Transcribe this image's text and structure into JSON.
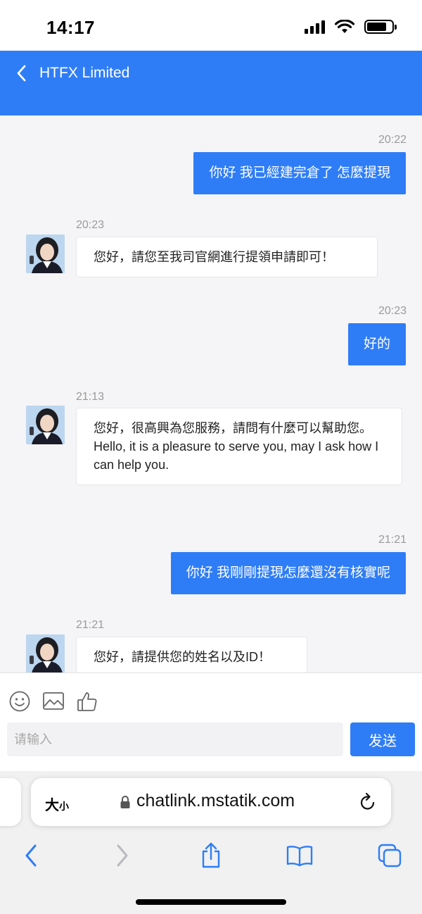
{
  "status_bar": {
    "time": "14:17"
  },
  "header": {
    "title": "HTFX Limited"
  },
  "messages": [
    {
      "time": "20:22",
      "text": "你好 我已經建完倉了 怎麼提現"
    },
    {
      "time": "20:23",
      "text": "您好，請您至我司官網進行提領申請即可！"
    },
    {
      "time": "20:23",
      "text": "好的"
    },
    {
      "time": "21:13",
      "text": "您好，很高興為您服務，請問有什麼可以幫助您。\nHello, it is a pleasure to serve you, may I ask how I can help you."
    },
    {
      "time": "21:21",
      "text": "你好 我剛剛提現怎麼還沒有核實呢"
    },
    {
      "time": "21:21",
      "text": "您好，請提供您的姓名以及ID！"
    }
  ],
  "composer": {
    "placeholder": "请输入",
    "send_label": "发送"
  },
  "browser": {
    "text_size_big": "大",
    "text_size_small": "小",
    "url": "chatlink.mstatik.com"
  },
  "colors": {
    "accent": "#2f7df6"
  }
}
